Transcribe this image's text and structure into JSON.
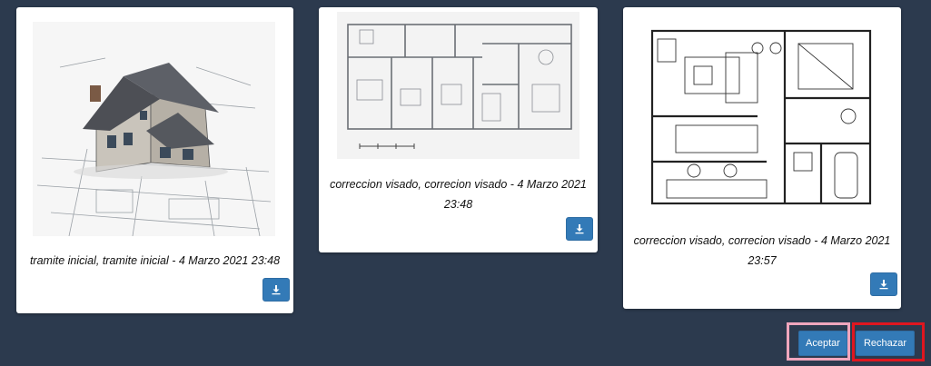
{
  "cards": [
    {
      "image_subject": "house-3d-render-on-blueprint",
      "caption": "tramite inicial, tramite inicial - 4 Marzo 2021 23:48",
      "download_icon": "download-icon"
    },
    {
      "image_subject": "apartment-floor-plan",
      "caption": "correccion visado, correcion visado - 4 Marzo 2021 23:48",
      "download_icon": "download-icon"
    },
    {
      "image_subject": "furnished-floor-plan",
      "caption": "correccion visado, correcion visado - 4 Marzo 2021 23:57",
      "download_icon": "download-icon"
    }
  ],
  "actions": {
    "accept_label": "Aceptar",
    "reject_label": "Rechazar"
  },
  "colors": {
    "background": "#2c3a4e",
    "button": "#337ab7",
    "accept_highlight": "#f0a6bd",
    "reject_highlight": "#e0161f"
  }
}
